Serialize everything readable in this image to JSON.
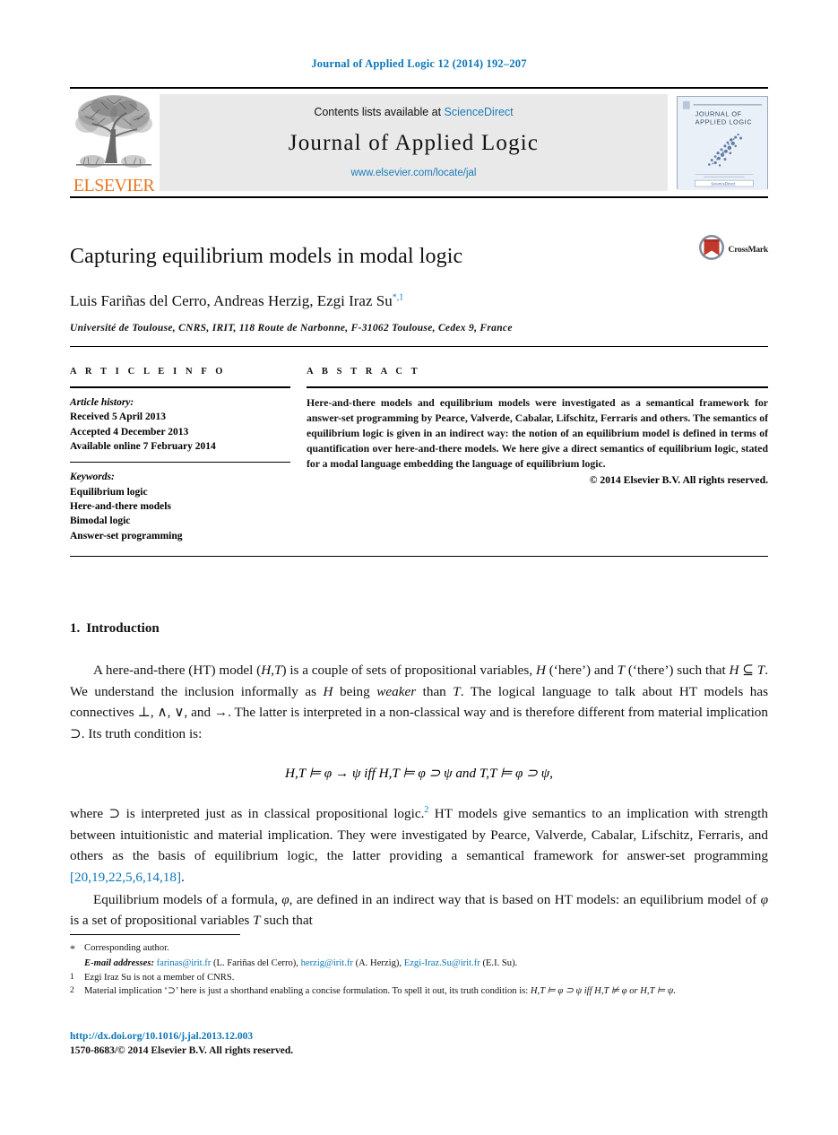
{
  "running_head": "Journal of Applied Logic 12 (2014) 192–207",
  "masthead": {
    "publisher_name": "ELSEVIER",
    "contents_prefix": "Contents lists available at ",
    "contents_link": "ScienceDirect",
    "journal_title": "Journal of Applied Logic",
    "journal_url": "www.elsevier.com/locate/jal",
    "cover_title_line1": "JOURNAL OF",
    "cover_title_line2": "APPLIED LOGIC"
  },
  "article": {
    "title": "Capturing equilibrium models in modal logic",
    "crossmark_label": "CrossMark",
    "authors": "Luis Fariñas del Cerro, Andreas Herzig, Ezgi Iraz Su",
    "author_sup": "*,1",
    "affiliation": "Université de Toulouse, CNRS, IRIT, 118 Route de Narbonne, F-31062 Toulouse, Cedex 9, France"
  },
  "info": {
    "heading": "A R T I C L E   I N F O",
    "history_label": "Article history:",
    "history": [
      "Received 5 April 2013",
      "Accepted 4 December 2013",
      "Available online 7 February 2014"
    ],
    "keywords_label": "Keywords:",
    "keywords": [
      "Equilibrium logic",
      "Here-and-there models",
      "Bimodal logic",
      "Answer-set programming"
    ]
  },
  "abstract": {
    "heading": "A B S T R A C T",
    "text": "Here-and-there models and equilibrium models were investigated as a semantical framework for answer-set programming by Pearce, Valverde, Cabalar, Lifschitz, Ferraris and others. The semantics of equilibrium logic is given in an indirect way: the notion of an equilibrium model is defined in terms of quantification over here-and-there models. We here give a direct semantics of equilibrium logic, stated for a modal language embedding the language of equilibrium logic.",
    "copyright": "© 2014 Elsevier B.V. All rights reserved."
  },
  "body": {
    "section_number": "1.",
    "section_title": "Introduction",
    "para1_a": "A here-and-there (HT) model (",
    "para1_b": ") is a couple of sets of propositional variables, ",
    "para1_c": " (‘here’) and ",
    "para1_d": " (‘there’) such that ",
    "para1_e": ". We understand the inclusion informally as ",
    "para1_f": " being ",
    "para1_weaker": "weaker",
    "para1_g": " than ",
    "para1_h": ". The logical language to talk about HT models has connectives ⊥, ∧, ∨, and →. The latter is interpreted in a non-classical way and is therefore different from material implication ⊃. Its truth condition is:",
    "formula": "H,T ⊨ φ → ψ   iff H,T ⊨ φ ⊃ ψ   and   T,T ⊨ φ ⊃ ψ,",
    "para2_a": "where ⊃ is interpreted just as in classical propositional logic.",
    "para2_sup": "2",
    "para2_b": " HT models give semantics to an implication with strength between intuitionistic and material implication. They were investigated by Pearce, Valverde, Cabalar, Lifschitz, Ferraris, and others as the basis of equilibrium logic, the latter providing a semantical framework for answer-set programming ",
    "para2_cite": "[20,19,22,5,6,14,18]",
    "para2_c": ".",
    "para3_a": "Equilibrium models of a formula, ",
    "para3_b": ", are defined in an indirect way that is based on HT models: an equilibrium model of ",
    "para3_c": " is a set of propositional variables ",
    "para3_d": " such that"
  },
  "footnotes": {
    "star_mark": "*",
    "star_text": "Corresponding author.",
    "email_label": "E-mail addresses:",
    "emails": [
      {
        "address": "farinas@irit.fr",
        "person": "(L. Fariñas del Cerro),"
      },
      {
        "address": "herzig@irit.fr",
        "person": "(A. Herzig),"
      },
      {
        "address": "Ezgi-Iraz.Su@irit.fr",
        "person": "(E.I. Su)."
      }
    ],
    "fn1_mark": "1",
    "fn1_text": "Ezgi Iraz Su is not a member of CNRS.",
    "fn2_mark": "2",
    "fn2_text_a": "Material implication ‘⊃’ here is just a shorthand enabling a concise formulation. To spell it out, its truth condition is: ",
    "fn2_formula": "H,T ⊨ φ ⊃ ψ iff H,T ⊭ φ or H,T ⊨ ψ."
  },
  "footer": {
    "doi": "http://dx.doi.org/10.1016/j.jal.2013.12.003",
    "issn_line": "1570-8683/© 2014 Elsevier B.V. All rights reserved."
  },
  "colors": {
    "link_blue": "#0b76b8",
    "elsevier_orange": "#e87722",
    "masthead_gray": "#e9e9e9"
  }
}
